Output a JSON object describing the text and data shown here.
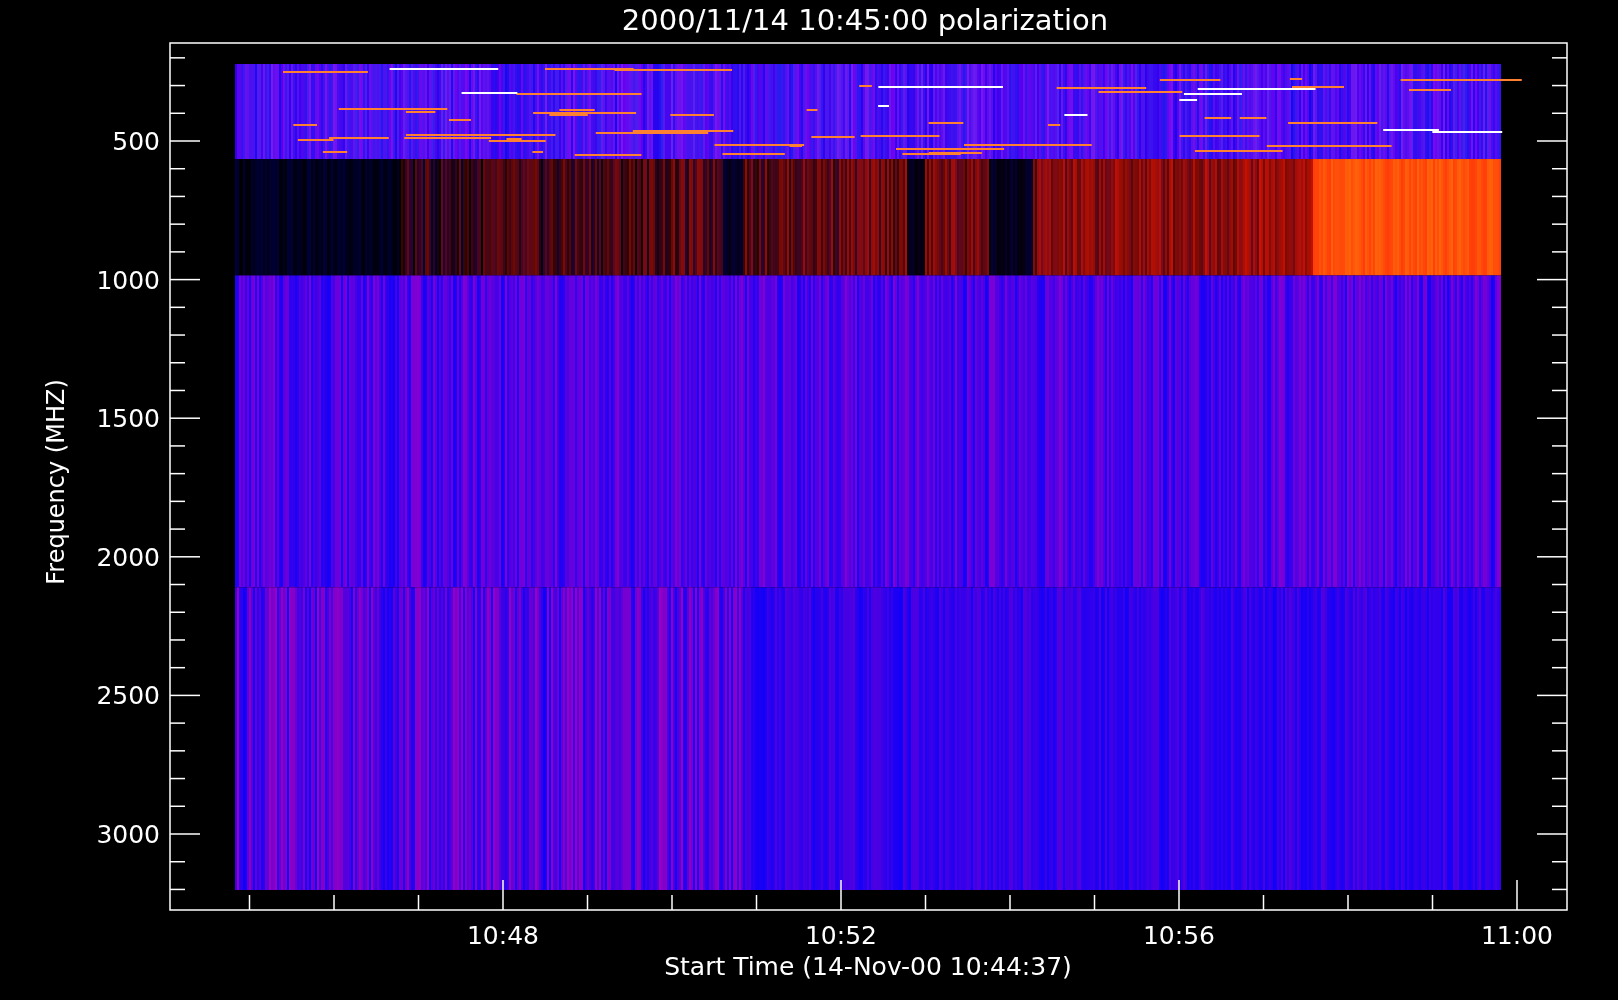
{
  "title": "2000/11/14 10:45:00 polarization",
  "y_axis": {
    "label": "Frequency (MHZ)",
    "ticks": [
      "500",
      "1000",
      "1500",
      "2000",
      "2500",
      "3000"
    ]
  },
  "x_axis": {
    "label": "Start Time (14-Nov-00 10:44:37)",
    "ticks": [
      "10:48",
      "10:52",
      "10:56",
      "11:00"
    ]
  }
}
